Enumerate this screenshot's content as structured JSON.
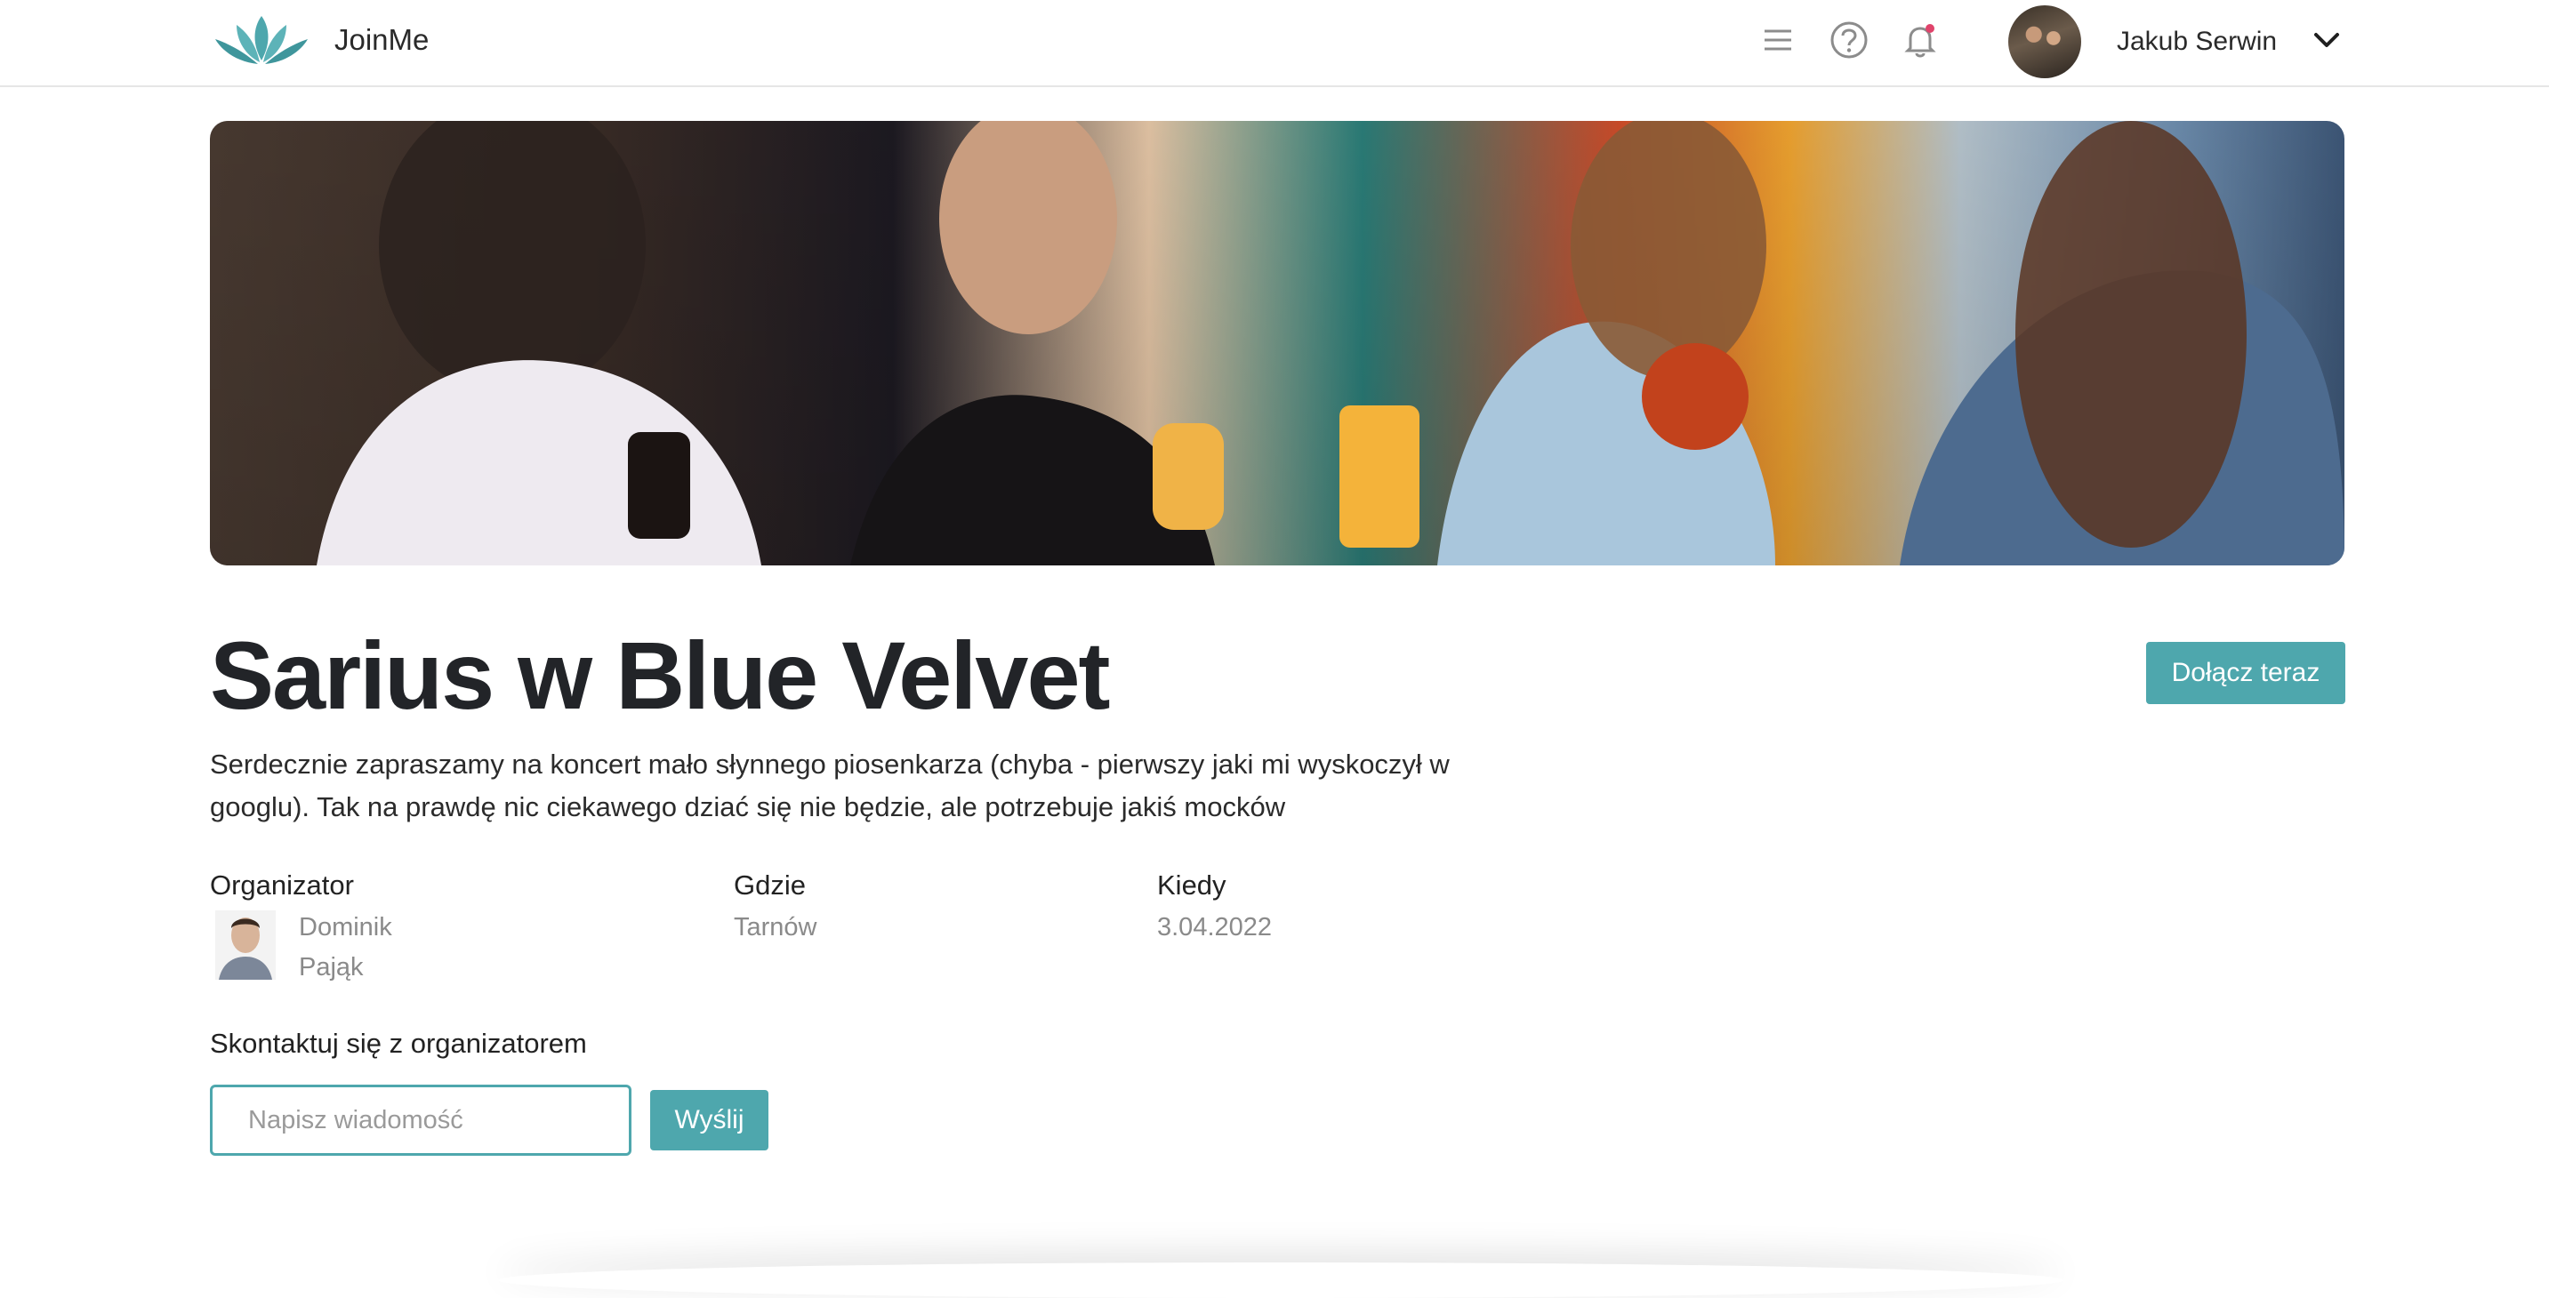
{
  "app": {
    "brand": "JoinMe",
    "logo_icon": "lotus-logo-icon",
    "accent_color": "#4ea7ad"
  },
  "header": {
    "icons": [
      "menu-icon",
      "help-icon",
      "bell-icon"
    ],
    "notification_dot_color": "#e0436b",
    "user": {
      "name": "Jakub Serwin"
    }
  },
  "event": {
    "title": "Sarius w Blue Velvet",
    "join_label": "Dołącz teraz",
    "description": "Serdecznie zapraszamy na koncert mało słynnego piosenkarza (chyba - pierwszy jaki mi wyskoczył w googlu). Tak na prawdę nic ciekawego dziać się nie będzie, ale potrzebuje jakiś mocków",
    "organizer": {
      "label": "Organizator",
      "first_name": "Dominik",
      "last_name": "Pająk"
    },
    "where": {
      "label": "Gdzie",
      "value": "Tarnów"
    },
    "when": {
      "label": "Kiedy",
      "value": "3.04.2022"
    }
  },
  "contact": {
    "label": "Skontaktuj się z organizatorem",
    "placeholder": "Napisz wiadomość",
    "send_label": "Wyślij"
  }
}
